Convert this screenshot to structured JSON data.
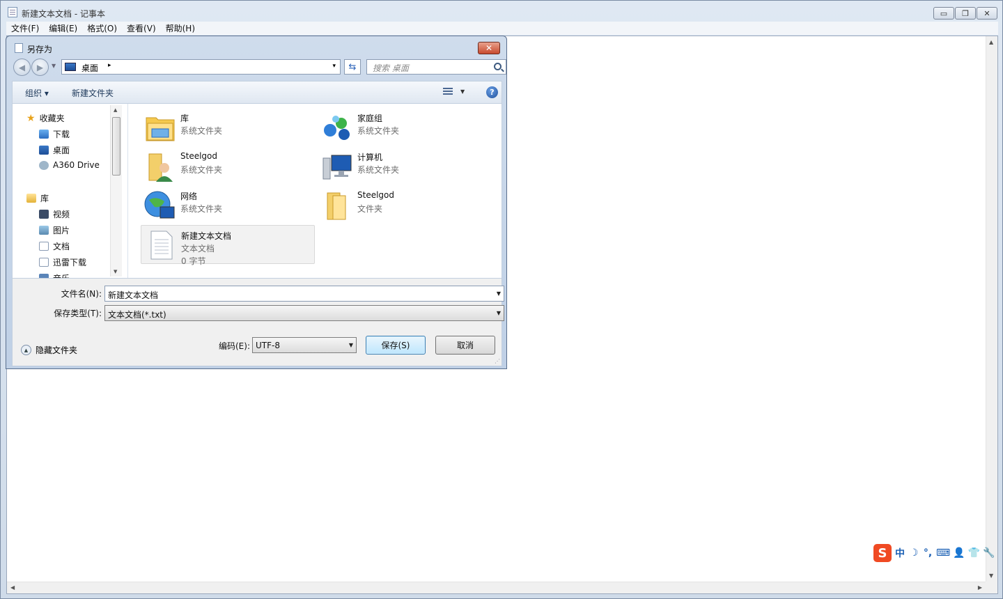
{
  "window": {
    "title": "新建文本文档 - 记事本",
    "controls": {
      "minimize": "▭",
      "restore": "❐",
      "close": "✕"
    }
  },
  "menubar": [
    "文件(F)",
    "编辑(E)",
    "格式(O)",
    "查看(V)",
    "帮助(H)"
  ],
  "dialog": {
    "title": "另存为",
    "close_glyph": "✕",
    "address": {
      "location": "桌面",
      "separator": "▸",
      "dropdown": "▾"
    },
    "search": {
      "placeholder": "搜索 桌面"
    },
    "toolbar": {
      "organize": "组织 ▾",
      "new_folder": "新建文件夹",
      "help": "?"
    },
    "nav": {
      "favorites": "收藏夹",
      "favorites_items": [
        "下载",
        "桌面",
        "A360 Drive"
      ],
      "libraries": "库",
      "libraries_items": [
        "视频",
        "图片",
        "文档",
        "迅雷下载",
        "音乐"
      ]
    },
    "items": [
      {
        "name": "库",
        "type": "系统文件夹",
        "icon": "library-icon"
      },
      {
        "name": "家庭组",
        "type": "系统文件夹",
        "icon": "homegroup-icon"
      },
      {
        "name": "Steelgod",
        "type": "系统文件夹",
        "icon": "user-folder-icon"
      },
      {
        "name": "计算机",
        "type": "系统文件夹",
        "icon": "computer-icon"
      },
      {
        "name": "网络",
        "type": "系统文件夹",
        "icon": "network-icon"
      },
      {
        "name": "Steelgod",
        "type": "文件夹",
        "icon": "folder-icon"
      },
      {
        "name": "新建文本文档",
        "type": "文本文档",
        "size": "0 字节",
        "icon": "text-file-icon",
        "selected": true
      }
    ],
    "filename_label": "文件名(N):",
    "filename_value": "新建文本文档",
    "filetype_label": "保存类型(T):",
    "filetype_value": "文本文档(*.txt)",
    "encoding_label": "编码(E):",
    "encoding_value": "UTF-8",
    "hide_folders": "隐藏文件夹",
    "save_button": "保存(S)",
    "cancel_button": "取消"
  },
  "ime": {
    "logo": "S",
    "items": [
      "中",
      "☽",
      "°,",
      "⌨",
      "👤",
      "👕",
      "🔧"
    ]
  },
  "colors": {
    "accent": "#3c7fb1",
    "close_red": "#c84b2f",
    "ime_brand": "#f04a23"
  }
}
